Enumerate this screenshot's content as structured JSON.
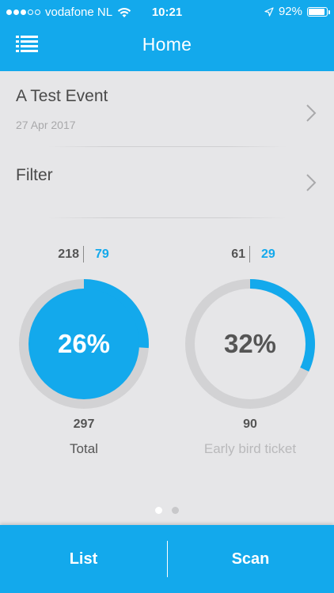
{
  "status_bar": {
    "carrier": "vodafone NL",
    "time": "10:21",
    "battery": "92%",
    "battery_level": 0.92
  },
  "nav": {
    "title": "Home",
    "menu_icon": "list-menu-icon"
  },
  "event": {
    "title": "A Test Event",
    "date": "27 Apr 2017"
  },
  "filter": {
    "label": "Filter"
  },
  "stats": [
    {
      "left_count": "218",
      "right_count": "79",
      "percent_label": "26%",
      "percent": 0.26,
      "total": "297",
      "caption": "Total"
    },
    {
      "left_count": "61",
      "right_count": "29",
      "percent_label": "32%",
      "percent": 0.32,
      "total": "90",
      "caption": "Early bird ticket"
    }
  ],
  "pager": {
    "pages": 2,
    "active": 0
  },
  "tabs": {
    "list_label": "List",
    "scan_label": "Scan"
  },
  "colors": {
    "accent": "#13a9ec",
    "ring_track": "#d2d2d4",
    "background": "#e6e6e8"
  }
}
